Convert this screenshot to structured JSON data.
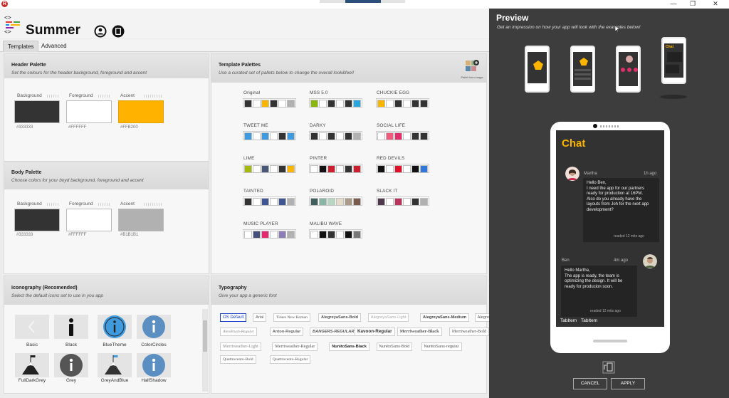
{
  "app": {
    "title": "Summer",
    "logo_icon": "code-brackets-icon",
    "header_icons": [
      "user-icon",
      "tablet-icon"
    ]
  },
  "window": {
    "controls": [
      "—",
      "❐",
      "✕"
    ],
    "app_icon": "R"
  },
  "tabs": [
    {
      "label": "Templates",
      "active": true
    },
    {
      "label": "Advanced",
      "active": false
    }
  ],
  "header_palette": {
    "title": "Header Palette",
    "subtitle": "Set the colours for the header background, foreground and accent",
    "swatches": [
      {
        "label": "Background",
        "hex": "#333333",
        "color": "#333333"
      },
      {
        "label": "Foreground",
        "hex": "#FFFFFF",
        "color": "#FFFFFF"
      },
      {
        "label": "Accent",
        "hex": "#FFB200",
        "color": "#FFB200"
      }
    ]
  },
  "body_palette": {
    "title": "Body Palette",
    "subtitle": "Choose colors for your boyd background, foreground and accent",
    "swatches": [
      {
        "label": "Background",
        "hex": "#333333",
        "color": "#333333"
      },
      {
        "label": "Foreground",
        "hex": "#FFFFFF",
        "color": "#FFFFFF"
      },
      {
        "label": "Accent",
        "hex": "#B1B1B1",
        "color": "#B1B1B1"
      }
    ]
  },
  "template_palettes": {
    "title": "Template Palettes",
    "subtitle": "Use a curated set of pallets below to change the overall look&feel!",
    "image_label": "Pallet from image",
    "palettes": [
      {
        "name": "Original",
        "colors": [
          "#333333",
          "#ffffff",
          "#fbb400",
          "#333333",
          "#ffffff",
          "#b1b1b1"
        ]
      },
      {
        "name": "MSS 5.0",
        "colors": [
          "#8bb60e",
          "#ffffff",
          "#333333",
          "#ffffff",
          "#333333",
          "#2aa6dd"
        ]
      },
      {
        "name": "CHUCKIE EGG",
        "colors": [
          "#fbb400",
          "#ffffff",
          "#333333",
          "#ffffff",
          "#333333",
          "#333333"
        ]
      },
      {
        "name": "TWEET ME",
        "colors": [
          "#3f9ade",
          "#ffffff",
          "#3f9ade",
          "#ffffff",
          "#333333",
          "#3f9ade"
        ]
      },
      {
        "name": "DARKY",
        "colors": [
          "#333333",
          "#ffffff",
          "#333333",
          "#ffffff",
          "#333333",
          "#b1b1b1"
        ]
      },
      {
        "name": "SOCIAL LIFE",
        "colors": [
          "#ffffff",
          "#ef5b7a",
          "#e02f6b",
          "#ffffff",
          "#333333",
          "#333333"
        ]
      },
      {
        "name": "LIME",
        "colors": [
          "#a5b80f",
          "#ffffff",
          "#4a5878",
          "#ffffff",
          "#333333",
          "#fbb400"
        ]
      },
      {
        "name": "PINTER",
        "colors": [
          "#ffffff",
          "#111111",
          "#cb1f2f",
          "#ffffff",
          "#333333",
          "#cb1f2f"
        ]
      },
      {
        "name": "RED DEVILS",
        "colors": [
          "#111111",
          "#ffffff",
          "#e0102a",
          "#ffffff",
          "#111111",
          "#2f78d8"
        ]
      },
      {
        "name": "TAINTED",
        "colors": [
          "#333333",
          "#ffffff",
          "#3f5692",
          "#ffffff",
          "#3f5692",
          "#b1b1b1"
        ]
      },
      {
        "name": "POLAROID",
        "colors": [
          "#425f5f",
          "#8bb6a5",
          "#b7d7c3",
          "#e4dcc8",
          "#a99a89",
          "#7a5b4e"
        ]
      },
      {
        "name": "SLACK IT",
        "colors": [
          "#4d394b",
          "#ffffff",
          "#b8345d",
          "#ffffff",
          "#333333",
          "#b1b1b1"
        ]
      },
      {
        "name": "MUSIC PLAYER",
        "colors": [
          "#ffffff",
          "#464f7a",
          "#e4286e",
          "#ffffff",
          "#8c7db7",
          "#b1b1b1"
        ]
      },
      {
        "name": "MALIBU WAVE",
        "colors": [
          "#ffffff",
          "#111111",
          "#333333",
          "#ffffff",
          "#111111",
          "#777777"
        ]
      }
    ]
  },
  "iconography": {
    "title": "Iconography (Recomended)",
    "subtitle": "Select the default icons set to use in you app",
    "sets": [
      {
        "name": "Basic",
        "icon": "chevron-left-icon"
      },
      {
        "name": "Black",
        "icon": "info-icon"
      },
      {
        "name": "BlueTheme",
        "icon": "info-circle-icon"
      },
      {
        "name": "ColorCircles",
        "icon": "info-circle-icon"
      },
      {
        "name": "FullDarkGrey",
        "icon": "mountain-flag-icon"
      },
      {
        "name": "Grey",
        "icon": "info-circle-icon"
      },
      {
        "name": "GreyAndBlue",
        "icon": "mountain-flag-icon"
      },
      {
        "name": "HalfShadow",
        "icon": "info-circle-icon"
      }
    ]
  },
  "typography": {
    "title": "Typography",
    "subtitle": "Give your app a generic font",
    "fonts": [
      "OS Default",
      "Arial",
      "Times New Roman",
      "AlegreyaSans-Bold",
      "AlegreyaSans-Light",
      "AlegreyaSans-Medium",
      "AlegreyaSans-Regular",
      "AlexBrush-Regular",
      "Anton-Regular",
      "BANGERS-REGULAR",
      "Kavoon-Regular",
      "Merriweather-Black",
      "Merriweather-Bold",
      "Merriweather-Light",
      "Merriweather-Regular",
      "NunitoSans-Black",
      "NunitoSans-Bold",
      "NunitoSans-regular",
      "Quattrocento-Bold",
      "Quattrocento-Regular"
    ],
    "selected": "OS Default"
  },
  "preview": {
    "title": "Preview",
    "subtitle": "Get an impression on how your app will look with the examples below!",
    "phone": {
      "screen_title": "Chat",
      "messages": [
        {
          "author": "Martha",
          "time": "1h ago",
          "text": "Hello Ben,\nI need the app for our partners ready for production at 16PM.\n Also do you already have the layouts from Joh  for the next app development?",
          "read": "readed 12 mits ago"
        },
        {
          "author": "Ben",
          "time": "4m ago",
          "text": "Hello Martha,\nThe app is ready, the team is optimizing the design. It will be ready for producion soon.",
          "read": "readed 12 mits ago"
        }
      ],
      "tabs": [
        "TabItem",
        "TabItem"
      ]
    },
    "rotate_icon": "rotate-device-icon",
    "cancel_label": "CANCEL",
    "apply_label": "APPLY"
  }
}
